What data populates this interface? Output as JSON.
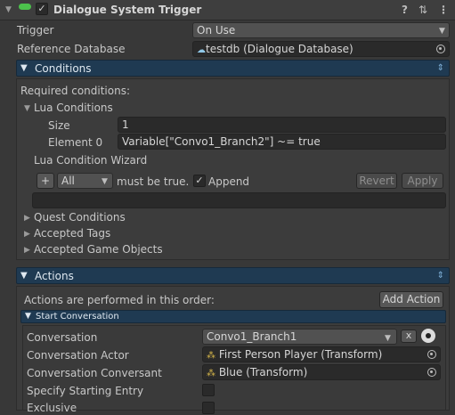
{
  "header": {
    "title": "Dialogue System Trigger",
    "enabled": true,
    "help_icon": "help-icon",
    "presets_icon": "sliders-icon",
    "menu_icon": "kebab-menu-icon"
  },
  "trigger": {
    "label": "Trigger",
    "value": "On Use"
  },
  "reference_database": {
    "label": "Reference Database",
    "value": "testdb (Dialogue Database)"
  },
  "conditions": {
    "section_label": "Conditions",
    "required_label": "Required conditions:",
    "lua_conditions_label": "Lua Conditions",
    "size_label": "Size",
    "size_value": "1",
    "element0_label": "Element 0",
    "element0_value": "Variable[\"Convo1_Branch2\"] ~= true",
    "wizard_label": "Lua Condition Wizard",
    "plus_label": "+",
    "mode_value": "All",
    "must_be_true": "must be true.",
    "append_label": "Append",
    "append_checked": true,
    "revert_label": "Revert",
    "apply_label": "Apply",
    "quest_conditions": "Quest Conditions",
    "accepted_tags": "Accepted Tags",
    "accepted_game_objects": "Accepted Game Objects"
  },
  "actions": {
    "section_label": "Actions",
    "order_text": "Actions are performed in this order:",
    "add_action_label": "Add Action",
    "start_conversation_label": "Start Conversation",
    "conversation_label": "Conversation",
    "conversation_value": "Convo1_Branch1",
    "clear_label": "x",
    "actor_label": "Conversation Actor",
    "actor_value": "First Person Player (Transform)",
    "conversant_label": "Conversation Conversant",
    "conversant_value": "Blue (Transform)",
    "starting_entry_label": "Specify Starting Entry",
    "exclusive_label": "Exclusive"
  },
  "colors": {
    "section_bar": "#1f3a52",
    "toggle_on": "#4cc24c",
    "background": "#383838"
  }
}
